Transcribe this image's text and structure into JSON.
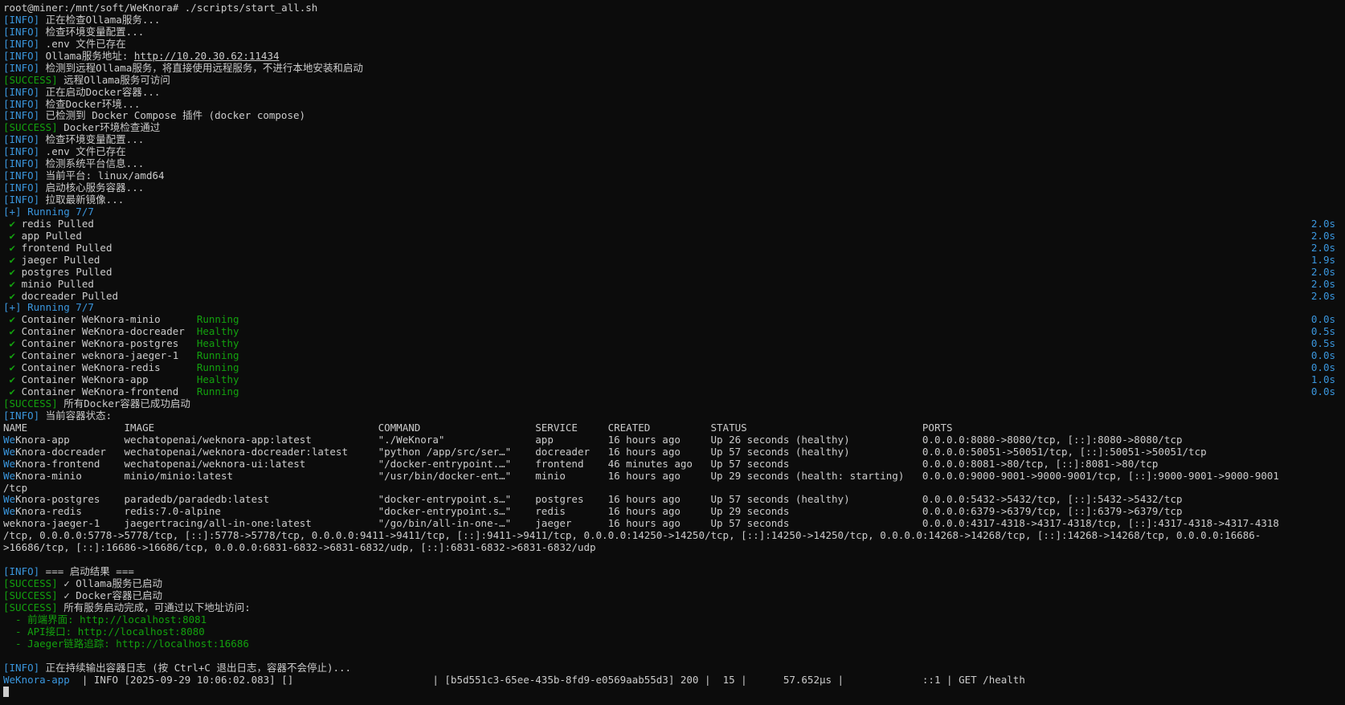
{
  "prompt": "root@miner:/mnt/soft/WeKnora# ./scripts/start_all.sh",
  "log1": [
    {
      "tag": "[INFO]",
      "text": " 正在检查Ollama服务..."
    },
    {
      "tag": "[INFO]",
      "text": " 检查环境变量配置..."
    },
    {
      "tag": "[INFO]",
      "text": " .env 文件已存在"
    }
  ],
  "ollama_line": {
    "tag": "[INFO]",
    "pre": " Ollama服务地址: ",
    "url": "http://10.20.30.62:11434"
  },
  "log2": [
    {
      "tag": "[INFO]",
      "text": " 检测到远程Ollama服务，将直接使用远程服务，不进行本地安装和启动",
      "ok": false
    },
    {
      "tag": "[SUCCESS]",
      "text": " 远程Ollama服务可访问",
      "ok": true
    },
    {
      "tag": "[INFO]",
      "text": " 正在启动Docker容器...",
      "ok": false
    },
    {
      "tag": "[INFO]",
      "text": " 检查Docker环境...",
      "ok": false
    },
    {
      "tag": "[INFO]",
      "text": " 已检测到 Docker Compose 插件 (docker compose)",
      "ok": false
    },
    {
      "tag": "[SUCCESS]",
      "text": " Docker环境检查通过",
      "ok": true
    },
    {
      "tag": "[INFO]",
      "text": " 检查环境变量配置...",
      "ok": false
    },
    {
      "tag": "[INFO]",
      "text": " .env 文件已存在",
      "ok": false
    },
    {
      "tag": "[INFO]",
      "text": " 检测系统平台信息...",
      "ok": false
    },
    {
      "tag": "[INFO]",
      "text": " 当前平台: linux/amd64",
      "ok": false
    },
    {
      "tag": "[INFO]",
      "text": " 启动核心服务容器...",
      "ok": false
    },
    {
      "tag": "[INFO]",
      "text": " 拉取最新镜像...",
      "ok": false
    }
  ],
  "running1": "[+] Running 7/7",
  "pulls": [
    {
      "check": " ✔",
      "name": " redis Pulled",
      "dur": "2.0s"
    },
    {
      "check": " ✔",
      "name": " app Pulled",
      "dur": "2.0s"
    },
    {
      "check": " ✔",
      "name": " frontend Pulled",
      "dur": "2.0s"
    },
    {
      "check": " ✔",
      "name": " jaeger Pulled",
      "dur": "1.9s"
    },
    {
      "check": " ✔",
      "name": " postgres Pulled",
      "dur": "2.0s"
    },
    {
      "check": " ✔",
      "name": " minio Pulled",
      "dur": "2.0s"
    },
    {
      "check": " ✔",
      "name": " docreader Pulled",
      "dur": "2.0s"
    }
  ],
  "running2": "[+] Running 7/7",
  "containers": [
    {
      "check": " ✔",
      "name": " Container WeKnora-minio      ",
      "state": "Running",
      "dur": "0.0s"
    },
    {
      "check": " ✔",
      "name": " Container WeKnora-docreader  ",
      "state": "Healthy",
      "dur": "0.5s"
    },
    {
      "check": " ✔",
      "name": " Container WeKnora-postgres   ",
      "state": "Healthy",
      "dur": "0.5s"
    },
    {
      "check": " ✔",
      "name": " Container weknora-jaeger-1   ",
      "state": "Running",
      "dur": "0.0s"
    },
    {
      "check": " ✔",
      "name": " Container WeKnora-redis      ",
      "state": "Running",
      "dur": "0.0s"
    },
    {
      "check": " ✔",
      "name": " Container WeKnora-app        ",
      "state": "Healthy",
      "dur": "1.0s"
    },
    {
      "check": " ✔",
      "name": " Container WeKnora-frontend   ",
      "state": "Running",
      "dur": "0.0s"
    }
  ],
  "log3": [
    {
      "tag": "[SUCCESS]",
      "text": " 所有Docker容器已成功启动",
      "ok": true
    },
    {
      "tag": "[INFO]",
      "text": " 当前容器状态:",
      "ok": false
    }
  ],
  "table": {
    "header": "NAME                IMAGE                                     COMMAND                   SERVICE     CREATED          STATUS                             PORTS",
    "rows": [
      {
        "name": "WeKnora-app",
        "pad": "         ",
        "rest": "wechatopenai/weknora-app:latest           \"./WeKnora\"               app         16 hours ago     Up 26 seconds (healthy)            0.0.0.0:8080->8080/tcp, [::]:8080->8080/tcp"
      },
      {
        "name": "WeKnora-docreader",
        "pad": "   ",
        "rest": "wechatopenai/weknora-docreader:latest     \"python /app/src/ser…\"    docreader   16 hours ago     Up 57 seconds (healthy)            0.0.0.0:50051->50051/tcp, [::]:50051->50051/tcp"
      },
      {
        "name": "WeKnora-frontend",
        "pad": "    ",
        "rest": "wechatopenai/weknora-ui:latest            \"/docker-entrypoint.…\"    frontend    46 minutes ago   Up 57 seconds                      0.0.0.0:8081->80/tcp, [::]:8081->80/tcp"
      },
      {
        "name": "WeKnora-minio",
        "pad": "       ",
        "rest": "minio/minio:latest                        \"/usr/bin/docker-ent…\"    minio       16 hours ago     Up 29 seconds (health: starting)   0.0.0.0:9000-9001->9000-9001/tcp, [::]:9000-9001->9000-9001"
      },
      {
        "name": "/tcp",
        "pad": "",
        "rest": ""
      },
      {
        "name": "WeKnora-postgres",
        "pad": "    ",
        "rest": "paradedb/paradedb:latest                  \"docker-entrypoint.s…\"    postgres    16 hours ago     Up 57 seconds (healthy)            0.0.0.0:5432->5432/tcp, [::]:5432->5432/tcp"
      },
      {
        "name": "WeKnora-redis",
        "pad": "       ",
        "rest": "redis:7.0-alpine                          \"docker-entrypoint.s…\"    redis       16 hours ago     Up 29 seconds                      0.0.0.0:6379->6379/tcp, [::]:6379->6379/tcp"
      },
      {
        "name": "weknora-jaeger-1",
        "pad": "    ",
        "rest": "jaegertracing/all-in-one:latest           \"/go/bin/all-in-one-…\"    jaeger      16 hours ago     Up 57 seconds                      0.0.0.0:4317-4318->4317-4318/tcp, [::]:4317-4318->4317-4318"
      },
      {
        "name": "/tcp, 0.0.0.0:5778->5778/tcp, [::]:5778->5778/tcp, 0.0.0.0:9411->9411/tcp, [::]:9411->9411/tcp, 0.0.0.0:14250->14250/tcp, [::]:14250->14250/tcp, 0.0.0.0:14268->14268/tcp, [::]:14268->14268/tcp, 0.0.0.0:16686-",
        "pad": "",
        "rest": ""
      },
      {
        "name": ">16686/tcp, [::]:16686->16686/tcp, 0.0.0.0:6831-6832->6831-6832/udp, [::]:6831-6832->6831-6832/udp",
        "pad": "",
        "rest": ""
      }
    ]
  },
  "result": {
    "title": {
      "tag": "[INFO]",
      "text": " === 启动结果 ==="
    },
    "ok1": {
      "tag": "[SUCCESS]",
      "text": " ✓ Ollama服务已启动"
    },
    "ok2": {
      "tag": "[SUCCESS]",
      "text": " ✓ Docker容器已启动"
    },
    "ok3": {
      "tag": "[SUCCESS]",
      "text": " 所有服务启动完成，可通过以下地址访问:"
    },
    "links": [
      "  - 前端界面: http://localhost:8081",
      "  - API接口: http://localhost:8080",
      "  - Jaeger链路追踪: http://localhost:16686"
    ]
  },
  "logs": {
    "tag": "[INFO]",
    "text": " 正在持续输出容器日志 (按 Ctrl+C 退出日志，容器不会停止)..."
  },
  "applog": {
    "source": "WeKnora-app",
    "rest": "  | INFO [2025-09-29 10:06:02.083] []                       | [b5d551c3-65ee-435b-8fd9-e0569aab55d3] 200 |  15 |      57.652µs |             ::1 | GET /health"
  },
  "colors": {
    "bg": "#0c0c0c",
    "text": "#cccccc",
    "info": "#3a96dd",
    "success": "#13a10e"
  }
}
